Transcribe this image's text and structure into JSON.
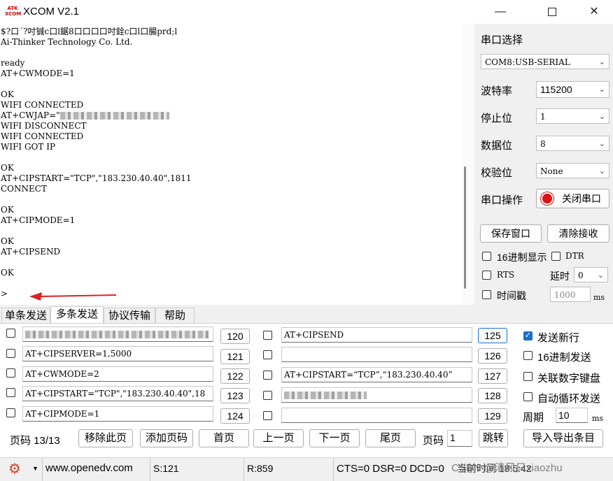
{
  "window": {
    "app_icon_text": "ATK XCOM",
    "title": "XCOM V2.1",
    "minimize_icon": "minimize-icon",
    "maximize_icon": "maximize-icon",
    "close_icon": "close-icon"
  },
  "terminal": {
    "lines": [
      "$?口´?吋铖c口l鋸8口口口口吋銓c口l口腸prd;l",
      "Ai-Thinker Technology Co. Ltd.",
      "",
      "ready",
      "AT+CWMODE=1",
      "",
      "OK",
      "WIFI CONNECTED",
      "AT+CWJAP=\"",
      "WIFI DISCONNECT",
      "WIFI CONNECTED",
      "WIFI GOT IP",
      "",
      "OK",
      "AT+CIPSTART=\"TCP\",\"183.230.40.40\",1811",
      "CONNECT",
      "",
      "OK",
      "AT+CIPMODE=1",
      "",
      "OK",
      "AT+CIPSEND",
      "",
      "OK",
      "",
      ">"
    ]
  },
  "serial": {
    "section_title": "串口选择",
    "port_value": "COM8:USB-SERIAL",
    "baud_label": "波特率",
    "baud_value": "115200",
    "stop_label": "停止位",
    "stop_value": "1",
    "data_label": "数据位",
    "data_value": "8",
    "parity_label": "校验位",
    "parity_value": "None",
    "op_label": "串口操作",
    "op_button": "关闭串口",
    "save_window": "保存窗口",
    "clear_receive": "清除接收",
    "hex_display": "16进制显示",
    "dtr": "DTR",
    "rts": "RTS",
    "delay_label": "延时",
    "delay_value": "0",
    "timestamp": "时间戳",
    "timestamp_value": "1000",
    "ms": "ms"
  },
  "tabs": [
    "单条发送",
    "多条发送",
    "协议传输",
    "帮助"
  ],
  "multi": {
    "left": [
      {
        "text": "",
        "num": "120"
      },
      {
        "text": "AT+CIPSERVER=1,5000",
        "num": "121"
      },
      {
        "text": "AT+CWMODE=2",
        "num": "122"
      },
      {
        "text": "AT+CIPSTART=\"TCP\",\"183.230.40.40\",18",
        "num": "123"
      },
      {
        "text": "AT+CIPMODE=1",
        "num": "124"
      }
    ],
    "right": [
      {
        "text": "AT+CIPSEND",
        "num": "125"
      },
      {
        "text": "",
        "num": "126"
      },
      {
        "text": "AT+CIPSTART=“TCP”,“183.230.40.40”",
        "num": "127"
      },
      {
        "text": "",
        "num": "128"
      },
      {
        "text": "",
        "num": "129"
      }
    ],
    "send_newline": "发送新行",
    "hex_send": "16进制发送",
    "keypad": "关联数字键盘",
    "auto_loop": "自动循环发送",
    "period_label": "周期",
    "period_value": "10",
    "ms": "ms"
  },
  "nav": {
    "page_label": "页码 13/13",
    "remove_page": "移除此页",
    "add_page": "添加页码",
    "first": "首页",
    "prev": "上一页",
    "next": "下一页",
    "last": "尾页",
    "page_text": "页码",
    "page_input": "1",
    "jump": "跳转",
    "import_export": "导入导出条目"
  },
  "status": {
    "website": "www.openedv.com",
    "sent": "S:121",
    "received": "R:859",
    "signals": "CTS=0 DSR=0 DCD=0",
    "time_fragment": "当前时间 18:5:42",
    "watermark": "CSDN @清风只xiaozhu"
  },
  "colors": {
    "accent": "#1a6fd1",
    "gear": "#e8391d",
    "arrow": "#e02020",
    "record": "#e01010"
  }
}
